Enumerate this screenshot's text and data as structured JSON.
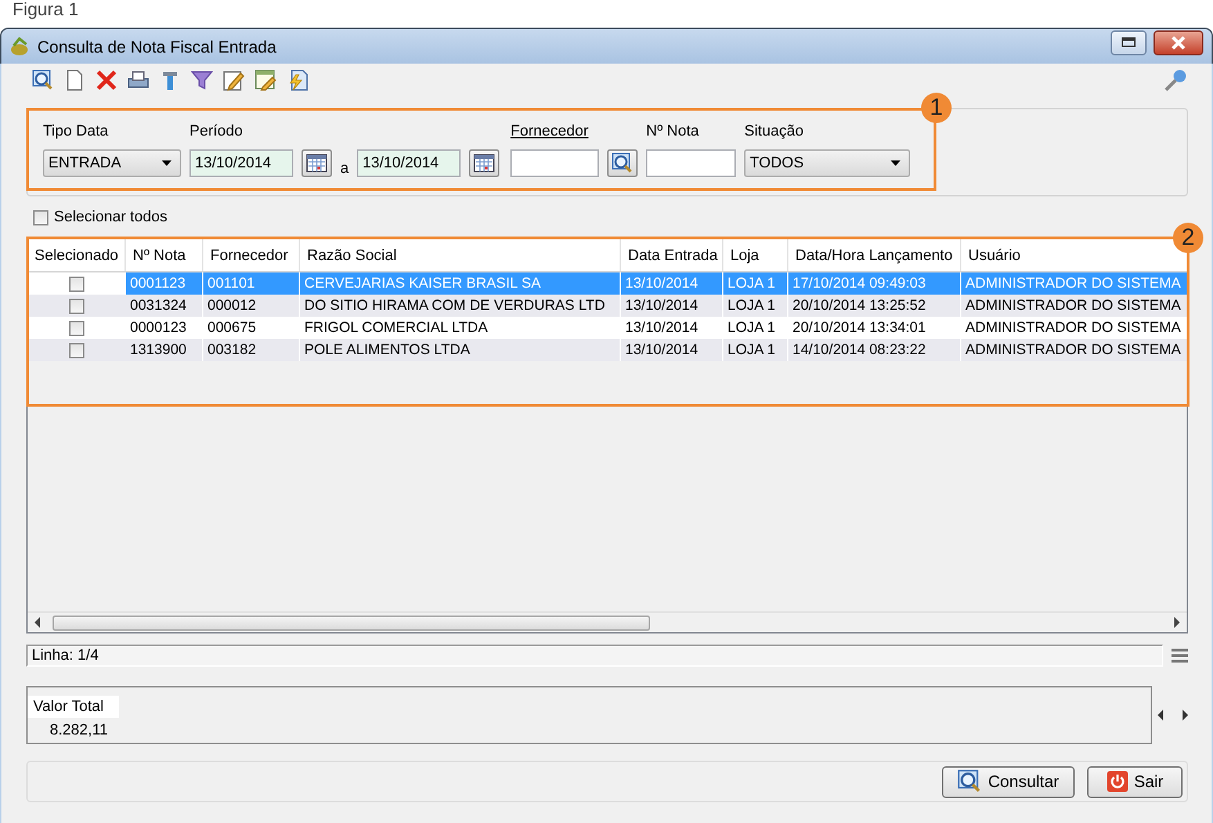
{
  "caption": "Figura 1",
  "window": {
    "title": "Consulta de Nota Fiscal Entrada"
  },
  "filters": {
    "tipo_data": {
      "label": "Tipo Data",
      "value": "ENTRADA"
    },
    "periodo": {
      "label": "Período",
      "from": "13/10/2014",
      "separator": "a",
      "to": "13/10/2014"
    },
    "fornecedor": {
      "label": "Fornecedor"
    },
    "numero_nota": {
      "label": "Nº Nota"
    },
    "situacao": {
      "label": "Situação",
      "value": "TODOS"
    }
  },
  "select_all": {
    "label": "Selecionar todos",
    "checked": false
  },
  "table": {
    "checkbox_column": "Selecionado",
    "columns": [
      "Nº Nota",
      "Fornecedor",
      "Razão Social",
      "Data Entrada",
      "Loja",
      "Data/Hora Lançamento",
      "Usuário"
    ],
    "rows": [
      {
        "selected": true,
        "checked": false,
        "cells": [
          "0001123",
          "001101",
          "CERVEJARIAS KAISER BRASIL SA",
          "13/10/2014",
          "LOJA 1",
          "17/10/2014 09:49:03",
          "ADMINISTRADOR DO SISTEMA"
        ]
      },
      {
        "selected": false,
        "checked": false,
        "cells": [
          "0031324",
          "000012",
          "DO SITIO HIRAMA COM DE VERDURAS LTD",
          "13/10/2014",
          "LOJA 1",
          "20/10/2014 13:25:52",
          "ADMINISTRADOR DO SISTEMA"
        ]
      },
      {
        "selected": false,
        "checked": false,
        "cells": [
          "0000123",
          "000675",
          "FRIGOL COMERCIAL LTDA",
          "13/10/2014",
          "LOJA 1",
          "20/10/2014 13:34:01",
          "ADMINISTRADOR DO SISTEMA"
        ]
      },
      {
        "selected": false,
        "checked": false,
        "cells": [
          "1313900",
          "003182",
          "POLE ALIMENTOS LTDA",
          "13/10/2014",
          "LOJA 1",
          "14/10/2014 08:23:22",
          "ADMINISTRADOR DO SISTEMA"
        ]
      }
    ]
  },
  "status": {
    "text": "Linha: 1/4"
  },
  "totals": {
    "label": "Valor Total",
    "value": "8.282,11"
  },
  "buttons": [
    {
      "label": "Consultar",
      "kind": "search"
    },
    {
      "label": "Sair",
      "kind": "exit"
    }
  ],
  "callouts": [
    "1",
    "2"
  ]
}
